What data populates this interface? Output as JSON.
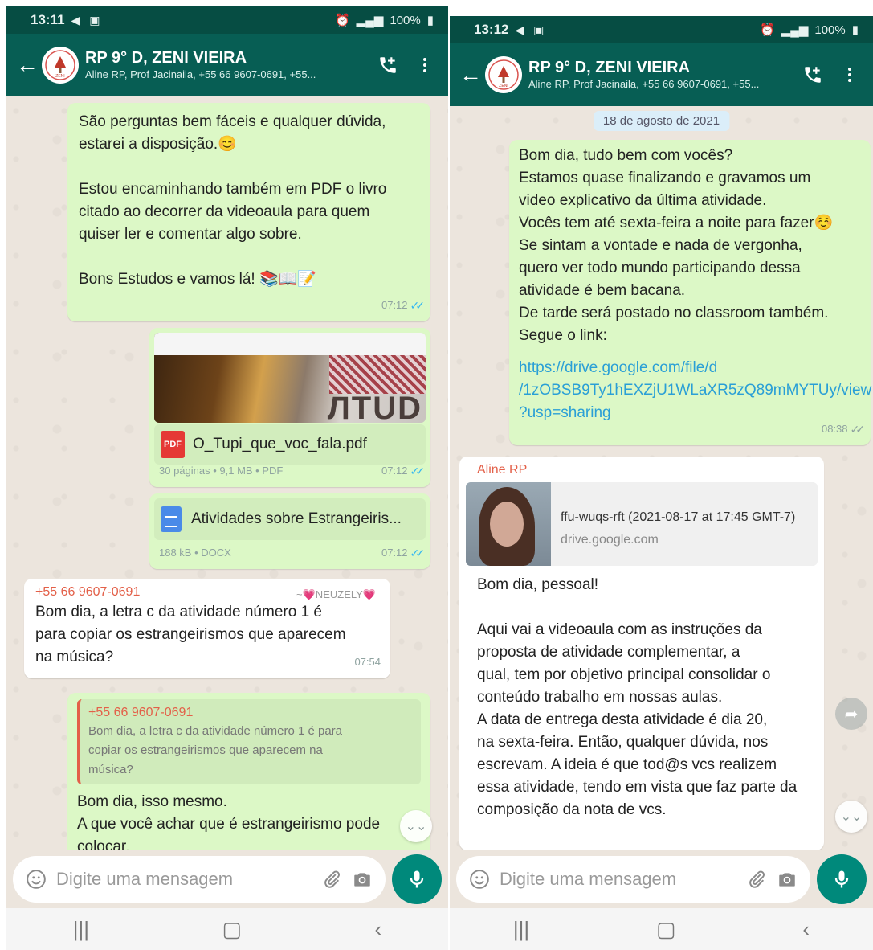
{
  "colors": {
    "header": "#075e54",
    "statusbar": "#064d43",
    "outgoing": "#dcf8c6",
    "incoming": "#ffffff",
    "sender": "#e36049",
    "link": "#2a9fd6",
    "mic": "#00897b"
  },
  "left": {
    "status": {
      "time": "13:11",
      "battery": "100%"
    },
    "header": {
      "title": "RP 9° D, ZENI VIEIRA",
      "members": "Aline RP, Prof Jacinaila, +55 66 9607-0691, +55..."
    },
    "messages": {
      "m1": {
        "text": "São perguntas bem fáceis e qualquer dúvida,\nestarei a disposição.😊\n\nEstou encaminhando também em PDF o livro\ncitado ao decorrer da videoaula para quem\nquiser ler e comentar algo sobre.\n\nBons Estudos e vamos lá! 📚📖📝",
        "time": "07:12"
      },
      "pdf": {
        "filename": "O_Tupi_que_voc_fala.pdf",
        "info": "30 páginas • 9,1 MB • PDF",
        "time": "07:12",
        "cover_text": "ЛTUD"
      },
      "docx": {
        "filename": "Atividades sobre Estrangeiris...",
        "info": "188 kB • DOCX",
        "time": "07:12"
      },
      "m4": {
        "sender": "+55 66 9607-0691",
        "sender_name": "~💗NEUZELY💗",
        "text": "Bom dia, a letra c da atividade número 1 é\npara copiar os estrangeirismos que aparecem\nna música?",
        "time": "07:54"
      },
      "m5": {
        "quote_sender": "+55 66 9607-0691",
        "quote_text": "Bom dia, a letra c da atividade número 1 é para\ncopiar os estrangeirismos que aparecem na\nmúsica?",
        "text": "Bom dia, isso mesmo.\nA que você achar que é estrangeirismo pode\ncolocar."
      }
    },
    "input": {
      "placeholder": "Digite uma mensagem"
    }
  },
  "right": {
    "status": {
      "time": "13:12",
      "battery": "100%"
    },
    "header": {
      "title": "RP 9° D, ZENI VIEIRA",
      "members": "Aline RP, Prof Jacinaila, +55 66 9607-0691, +55..."
    },
    "date": "18 de agosto de 2021",
    "messages": {
      "m1": {
        "text": "Bom dia, tudo bem com vocês?\nEstamos quase finalizando e gravamos um\nvideo explicativo da última atividade.\nVocês tem até sexta-feira a noite para fazer☺️\nSe sintam a vontade e nada de vergonha,\nquero ver todo mundo participando dessa\natividade é bem bacana.\nDe tarde será postado no classroom também.\nSegue o link:",
        "link": "https://drive.google.com/file/d\n/1zOBSB9Ty1hEXZjU1WLaXR5zQ89mMYTUy/view\n?usp=sharing",
        "time": "08:38"
      },
      "m2": {
        "sender": "Aline RP",
        "preview_title": "ffu-wuqs-rft (2021-08-17 at 17:45 GMT-7)",
        "preview_domain": "drive.google.com",
        "text": "Bom dia, pessoal!\n\n Aqui vai a videoaula com as instruções da\nproposta de atividade complementar, a\nqual, tem por objetivo principal consolidar o\nconteúdo trabalho em nossas aulas.\nA data de entrega desta atividade é dia 20,\nna sexta-feira. Então, qualquer dúvida, nos\nescrevam. A ideia é que tod@s vcs realizem\nessa atividade, tendo em vista que faz parte da\ncomposição da nota de vcs."
      }
    },
    "input": {
      "placeholder": "Digite uma mensagem"
    }
  },
  "icons": [
    "back-arrow-icon",
    "group-avatar-icon",
    "add-call-icon",
    "more-vert-icon",
    "emoji-icon",
    "attach-icon",
    "camera-icon",
    "mic-icon",
    "scroll-down-icon",
    "forward-icon",
    "pdf-icon",
    "docx-icon",
    "read-ticks-icon"
  ]
}
